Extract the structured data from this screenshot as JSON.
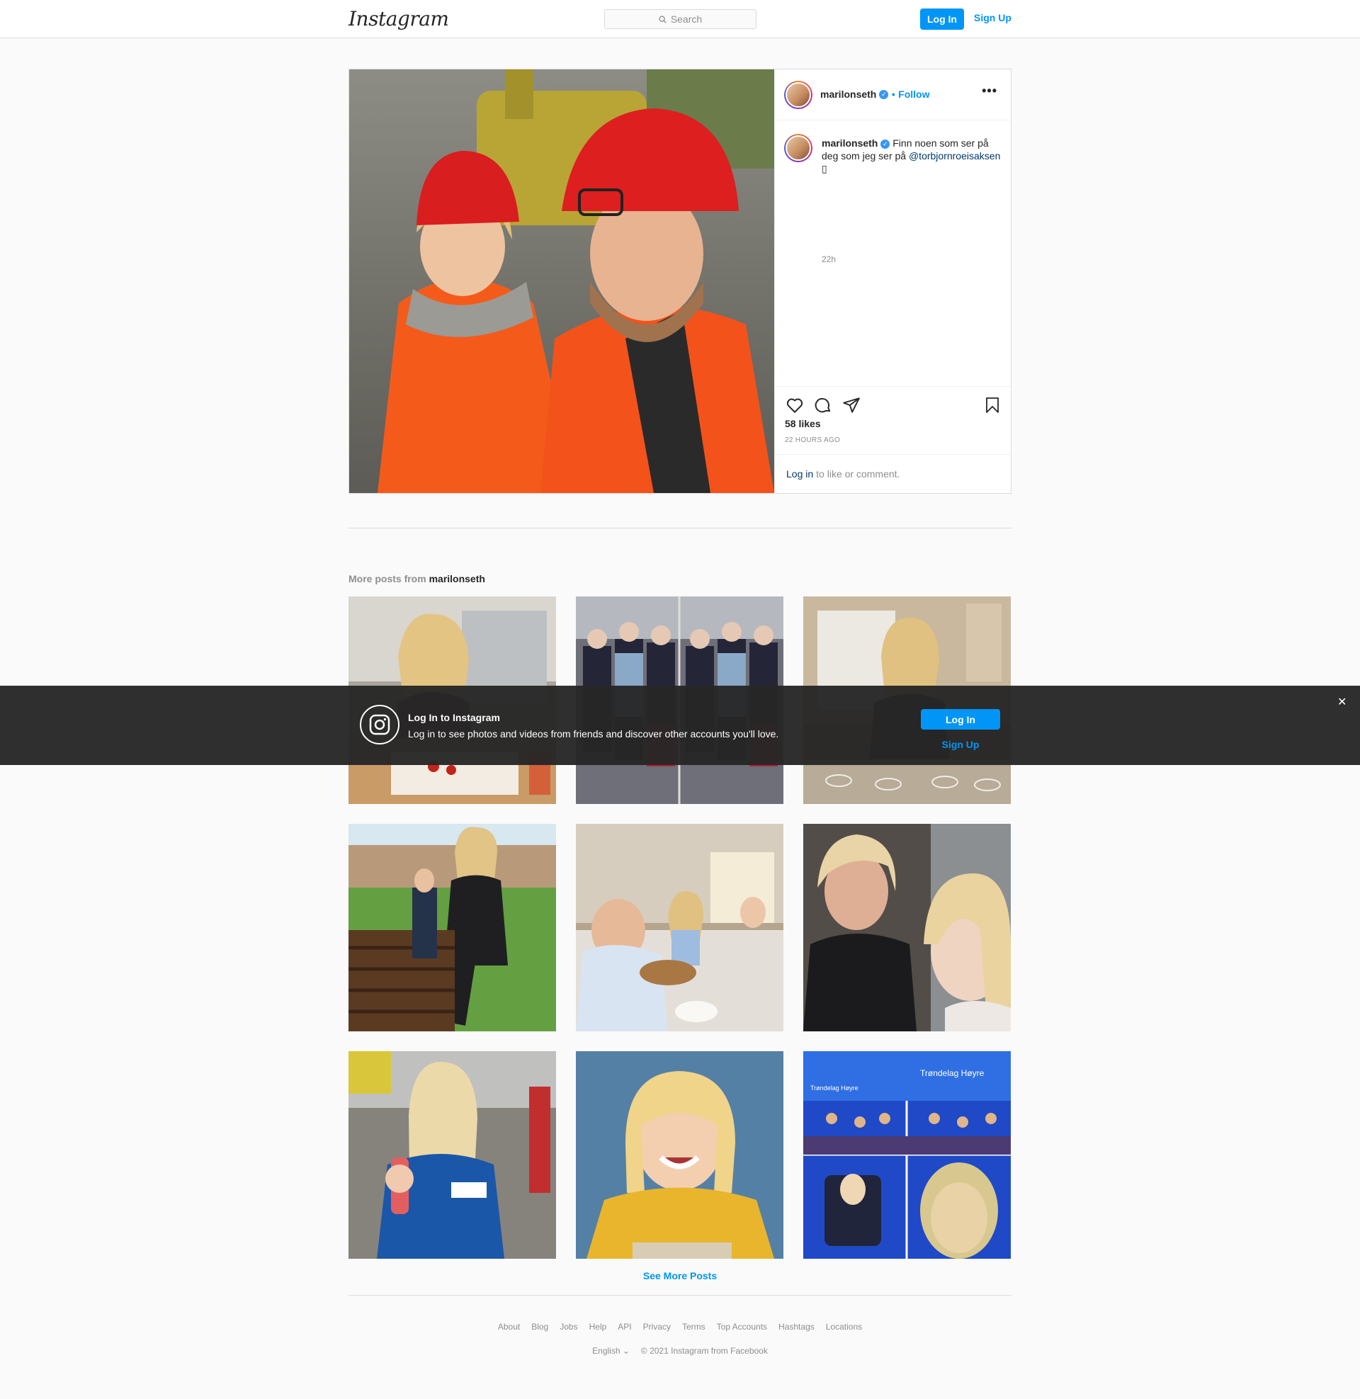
{
  "header": {
    "logo": "Instagram",
    "search_placeholder": "Search",
    "login": "Log In",
    "signup": "Sign Up"
  },
  "post": {
    "username": "marilonseth",
    "follow_separator": "•",
    "follow": "Follow",
    "more": "•••",
    "caption_text": "Finn noen som ser på deg som jeg ser på ",
    "caption_mention": "@torbjornroeisaksen",
    "caption_emoji": "▯",
    "age": "22h",
    "likes": "58 likes",
    "ago": "22 HOURS AGO",
    "login_link": "Log in",
    "login_rest": "to like or comment."
  },
  "more_posts": {
    "label": "More posts from",
    "username": "marilonseth"
  },
  "see_more": "See More Posts",
  "footer": {
    "links": [
      "About",
      "Blog",
      "Jobs",
      "Help",
      "API",
      "Privacy",
      "Terms",
      "Top Accounts",
      "Hashtags",
      "Locations"
    ],
    "language": "English",
    "copyright": "© 2021 Instagram from Facebook"
  },
  "banner": {
    "title": "Log In to Instagram",
    "subtitle": "Log in to see photos and videos from friends and discover other accounts you'll love.",
    "login": "Log In",
    "signup": "Sign Up",
    "close": "✕"
  },
  "colors": {
    "accent": "#0095f6",
    "mention": "#00376b",
    "muted": "#8e8e8e",
    "border": "#dbdbdb"
  }
}
